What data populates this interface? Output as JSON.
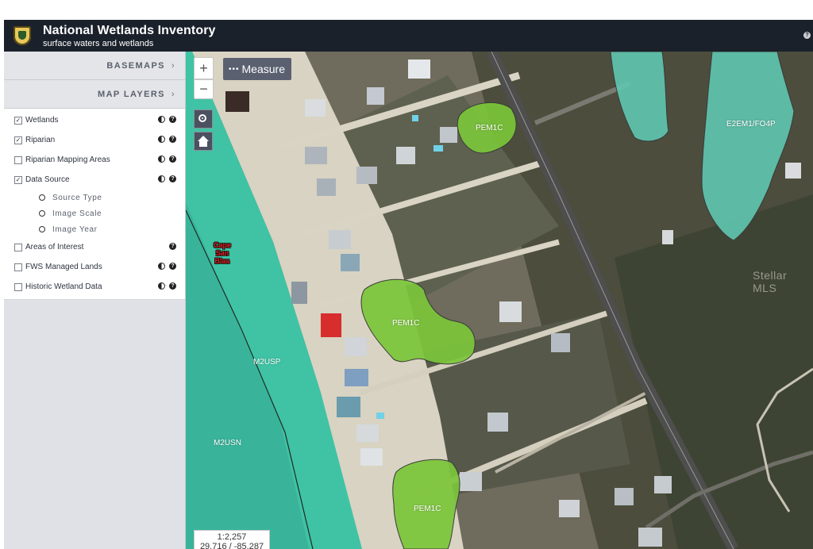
{
  "header": {
    "title": "National Wetlands Inventory",
    "subtitle": "surface waters and wetlands",
    "help_icon": "?"
  },
  "sidebar": {
    "basemaps_label": "BASEMAPS",
    "map_layers_label": "MAP LAYERS",
    "chevron": "›",
    "layers": [
      {
        "label": "Wetlands",
        "checked": true,
        "contrast_icon": true,
        "info_icon": true
      },
      {
        "label": "Riparian",
        "checked": true,
        "contrast_icon": true,
        "info_icon": true
      },
      {
        "label": "Riparian Mapping Areas",
        "checked": false,
        "contrast_icon": true,
        "info_icon": true
      },
      {
        "label": "Data Source",
        "checked": true,
        "contrast_icon": true,
        "info_icon": true
      },
      {
        "label": "Areas of Interest",
        "checked": false,
        "contrast_icon": false,
        "info_icon": true
      },
      {
        "label": "FWS Managed Lands",
        "checked": false,
        "contrast_icon": true,
        "info_icon": true
      },
      {
        "label": "Historic Wetland Data",
        "checked": false,
        "contrast_icon": true,
        "info_icon": true
      }
    ],
    "data_source_options": [
      "Source Type",
      "Image Scale",
      "Image Year"
    ]
  },
  "map": {
    "zoom_in": "+",
    "zoom_out": "−",
    "measure_label": "Measure",
    "measure_dots": "•••",
    "wetland_labels": {
      "pem1c_top": "PEM1C",
      "pem1c_mid": "PEM1C",
      "pem1c_bottom": "PEM1C",
      "e2em1": "E2EM1/FO4P",
      "m2usp": "M2USP",
      "m2usn": "M2USN"
    },
    "place_name": [
      "Cape",
      "San",
      "Blas"
    ],
    "watermark": "Stellar MLS",
    "scale": "1:2,257",
    "coordinates": "29.716 / -85.287"
  },
  "colors": {
    "header_bg": "#1b212b",
    "sidebar_bg": "#dfe1e6",
    "wetland_green": "#7bc63a",
    "marine_teal": "#3fc3a4",
    "estuarine_teal": "#5fc6b0"
  }
}
